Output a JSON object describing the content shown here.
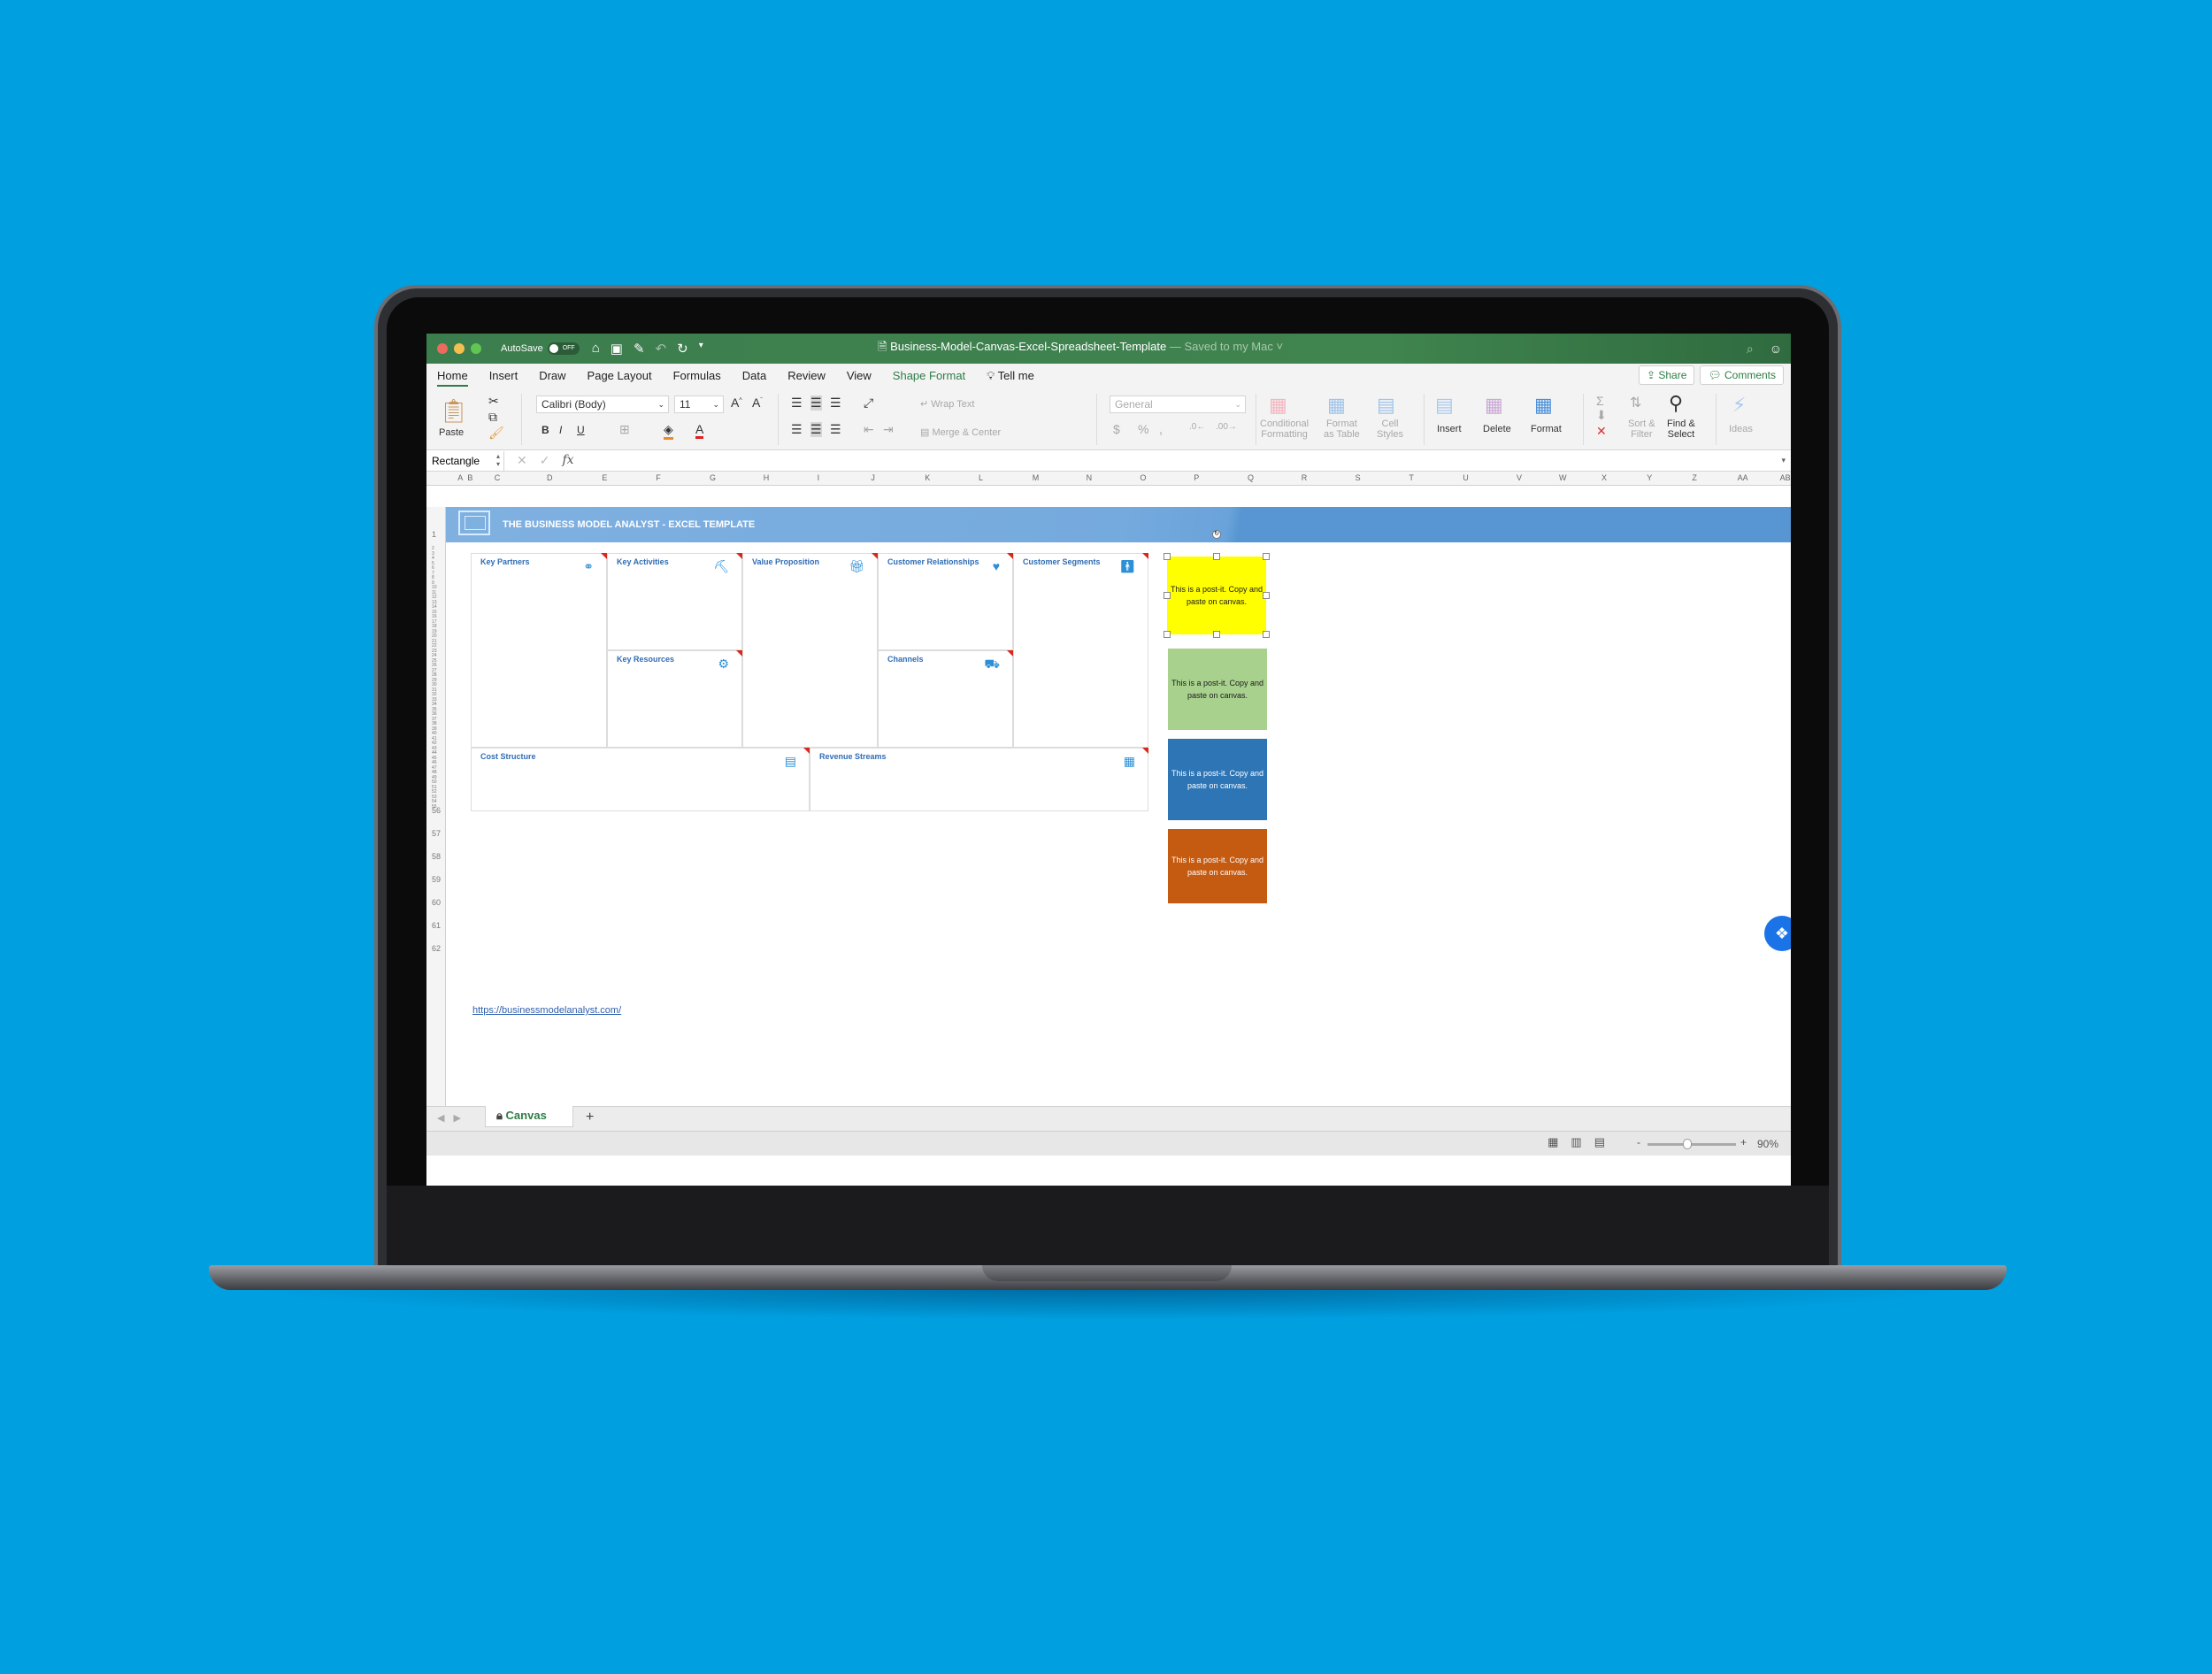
{
  "window": {
    "autosave_label": "AutoSave",
    "autosave_state": "OFF",
    "doc_name": "Business-Model-Canvas-Excel-Spreadsheet-Template",
    "save_status": " — Saved to my Mac ˅",
    "traffic_colors": [
      "#ed6a5e",
      "#f5bf4f",
      "#61c554"
    ]
  },
  "menu": {
    "tabs": [
      "Home",
      "Insert",
      "Draw",
      "Page Layout",
      "Formulas",
      "Data",
      "Review",
      "View",
      "Shape Format"
    ],
    "tell_me": "Tell me",
    "share": "Share",
    "comments": "Comments"
  },
  "ribbon": {
    "paste": "Paste",
    "font_name": "Calibri (Body)",
    "font_size": "11",
    "wrap_text": "Wrap Text",
    "merge_center": "Merge & Center",
    "number_format": "General",
    "conditional_formatting": [
      "Conditional",
      "Formatting"
    ],
    "format_as_table": [
      "Format",
      "as Table"
    ],
    "cell_styles": [
      "Cell",
      "Styles"
    ],
    "insert": "Insert",
    "delete": "Delete",
    "format": "Format",
    "sort_filter": [
      "Sort &",
      "Filter"
    ],
    "find_select": [
      "Find &",
      "Select"
    ],
    "ideas": "Ideas"
  },
  "formula_bar": {
    "name_box": "Rectangle",
    "formula": ""
  },
  "columns": [
    "A",
    "B",
    "C",
    "D",
    "E",
    "F",
    "G",
    "H",
    "I",
    "J",
    "K",
    "L",
    "M",
    "N",
    "O",
    "P",
    "Q",
    "R",
    "S",
    "T",
    "U",
    "V",
    "W",
    "X",
    "Y",
    "Z",
    "AA",
    "AB"
  ],
  "rows_visible": [
    "1",
    "2",
    "3",
    "4",
    "5",
    "6",
    "7",
    "8",
    "9",
    "10",
    "11",
    "12",
    "13",
    "14",
    "15",
    "16",
    "17",
    "18",
    "19",
    "20",
    "21",
    "22",
    "23",
    "24",
    "25",
    "26",
    "27",
    "28",
    "29",
    "30",
    "31",
    "32",
    "33",
    "34",
    "35",
    "36",
    "37",
    "38",
    "39",
    "40",
    "41",
    "42",
    "43",
    "44",
    "45",
    "46",
    "47",
    "48",
    "49",
    "50",
    "51",
    "52",
    "53",
    "54",
    "55",
    "56",
    "57",
    "58",
    "59",
    "60",
    "61",
    "62"
  ],
  "sheet": {
    "banner_title": "THE BUSINESS MODEL ANALYST - EXCEL TEMPLATE",
    "blocks": {
      "key_partners": "Key Partners",
      "key_activities": "Key Activities",
      "key_resources": "Key Resources",
      "value_proposition": "Value Proposition",
      "customer_relationships": "Customer Relationships",
      "channels": "Channels",
      "customer_segments": "Customer Segments",
      "cost_structure": "Cost Structure",
      "revenue_streams": "Revenue Streams"
    },
    "postits": [
      {
        "text": "This is a post-it. Copy and paste on canvas.",
        "color": "#ffff00",
        "text_color": "#1a1a1a",
        "selected": true
      },
      {
        "text": "This is a post-it. Copy and paste on canvas.",
        "color": "#a9d18e",
        "text_color": "#1a1a1a",
        "selected": false
      },
      {
        "text": "This is a post-it. Copy and paste on canvas.",
        "color": "#2e75b6",
        "text_color": "#ffffff",
        "selected": false
      },
      {
        "text": "This is a post-it. Copy and paste on canvas.",
        "color": "#c55a11",
        "text_color": "#ffffff",
        "selected": false
      }
    ],
    "link": "https://businessmodelanalyst.com/"
  },
  "sheet_tabs": {
    "active": "Canvas",
    "add": "+"
  },
  "status_bar": {
    "zoom": "90%",
    "zoom_fraction": 0.45
  },
  "colors": {
    "background": "#009fe0",
    "excel_green": "#2e7d46",
    "label_blue": "#2f6db5"
  }
}
